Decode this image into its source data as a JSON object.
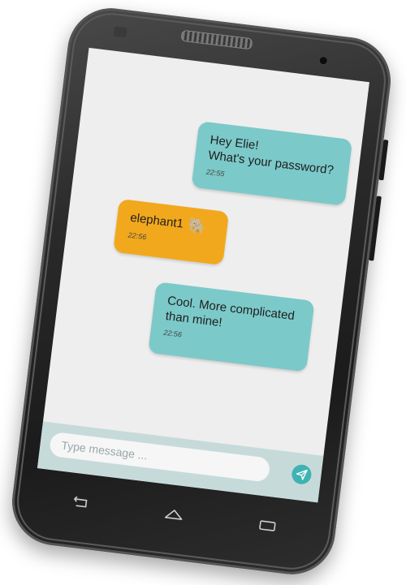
{
  "chat": {
    "messages": [
      {
        "text": "Hey Elie!\nWhat's your password?",
        "time": "22:55",
        "sender": "other",
        "color": "#7cc9c9"
      },
      {
        "text": "elephant1",
        "time": "22:56",
        "sender": "me",
        "color": "#f2a81d",
        "icon": "elephant-icon"
      },
      {
        "text": "Cool. More complicated than mine!",
        "time": "22:56",
        "sender": "other",
        "color": "#7cc9c9"
      }
    ]
  },
  "composer": {
    "placeholder": "Type message ...",
    "value": "",
    "send_icon": "send-icon"
  },
  "nav": {
    "back_icon": "back-icon",
    "home_icon": "home-icon",
    "recents_icon": "recents-icon"
  },
  "colors": {
    "bubble_teal": "#7cc9c9",
    "bubble_orange": "#f2a81d",
    "input_bar": "#c7dada",
    "send_button": "#3fb3b3",
    "screen_bg": "#eeeeee"
  }
}
